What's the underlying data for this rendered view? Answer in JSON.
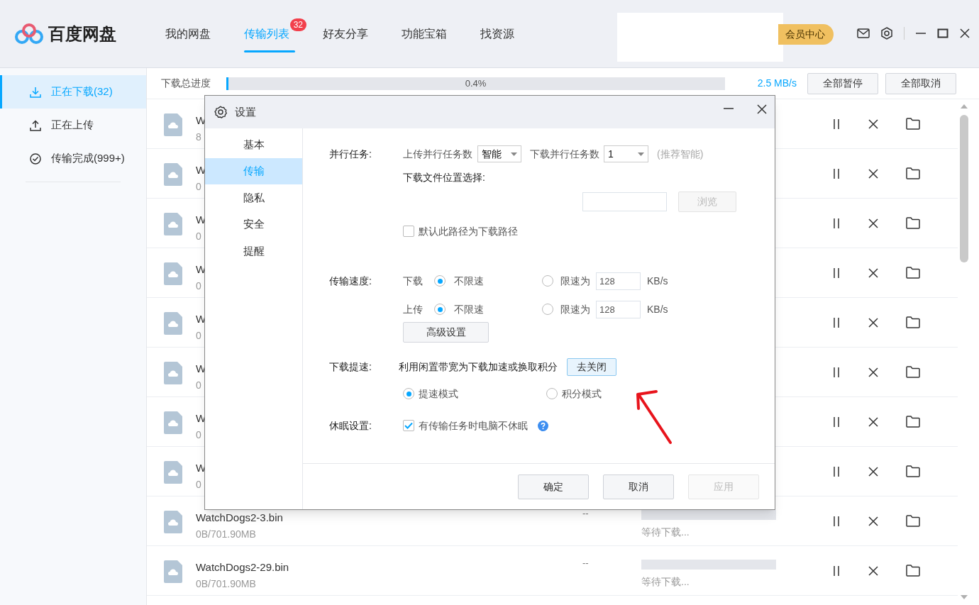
{
  "app": {
    "name": "百度网盘"
  },
  "nav_tabs": [
    {
      "label": "我的网盘",
      "selected": false
    },
    {
      "label": "传输列表",
      "selected": true,
      "badge": "32"
    },
    {
      "label": "好友分享",
      "selected": false
    },
    {
      "label": "功能宝箱",
      "selected": false
    },
    {
      "label": "找资源",
      "selected": false
    }
  ],
  "header": {
    "vip_button": "会员中心"
  },
  "sidebar": {
    "items": [
      {
        "kind": "download",
        "label": "正在下载(32)",
        "selected": true
      },
      {
        "kind": "upload",
        "label": "正在上传",
        "selected": false
      },
      {
        "kind": "done",
        "label": "传输完成(999+)",
        "selected": false
      }
    ]
  },
  "progress": {
    "label": "下载总进度",
    "level": 0.004,
    "reading": "0.4%",
    "speed": "2.5 MB/s",
    "buttons": [
      "全部暂停",
      "全部取消"
    ]
  },
  "tasks": [
    {
      "name": "W",
      "size": "8"
    },
    {
      "name": "W",
      "size": "0"
    },
    {
      "name": "W",
      "size": "0"
    },
    {
      "name": "W",
      "size": "0"
    },
    {
      "name": "W",
      "size": "0"
    },
    {
      "name": "W",
      "size": "0"
    },
    {
      "name": "W",
      "size": "0"
    },
    {
      "name": "W",
      "size": "0"
    },
    {
      "name": "WatchDogs2-3.bin",
      "size": "0B/701.90MB",
      "speed": "--",
      "level": 0,
      "status": "等待下载..."
    },
    {
      "name": "WatchDogs2-29.bin",
      "size": "0B/701.90MB",
      "speed": "--",
      "level": 0,
      "status": "等待下载..."
    }
  ],
  "dialog": {
    "title": "设置",
    "nav": [
      {
        "label": "基本",
        "selected": false
      },
      {
        "label": "传输",
        "selected": true
      },
      {
        "label": "隐私",
        "selected": false
      },
      {
        "label": "安全",
        "selected": false
      },
      {
        "label": "提醒",
        "selected": false
      }
    ],
    "parallel": {
      "label": "并行任务:",
      "upload_label": "上传并行任务数",
      "upload_value": "智能",
      "download_label": "下载并行任务数",
      "download_value": "1",
      "hint": "(推荐智能)"
    },
    "location": {
      "label": "下载文件位置选择:",
      "browse": "浏览",
      "browse_disabled": true,
      "checkbox": {
        "label": "默认此路径为下载路径",
        "checked": false
      }
    },
    "speed": {
      "label": "传输速度:",
      "rows": [
        {
          "label": "下载",
          "options": [
            {
              "label": "不限速",
              "selected": true
            },
            {
              "label": "限速为",
              "selected": false
            }
          ],
          "value": "128",
          "unit": "KB/s"
        },
        {
          "label": "上传",
          "options": [
            {
              "label": "不限速",
              "selected": true
            },
            {
              "label": "限速为",
              "selected": false
            }
          ],
          "value": "128",
          "unit": "KB/s"
        }
      ]
    },
    "advanced_button": "高级设置",
    "accel": {
      "label": "下载提速:",
      "text": "利用闲置带宽为下载加速或换取积分",
      "button": "去关闭",
      "modes": [
        {
          "label": "提速模式",
          "selected": true
        },
        {
          "label": "积分模式",
          "selected": false
        }
      ]
    },
    "sleep": {
      "label": "休眠设置:",
      "checkbox": {
        "label": "有传输任务时电脑不休眠",
        "checked": true
      }
    },
    "buttons": [
      {
        "label": "确定",
        "disabled": false
      },
      {
        "label": "取消",
        "disabled": false
      },
      {
        "label": "应用",
        "disabled": true
      }
    ]
  }
}
